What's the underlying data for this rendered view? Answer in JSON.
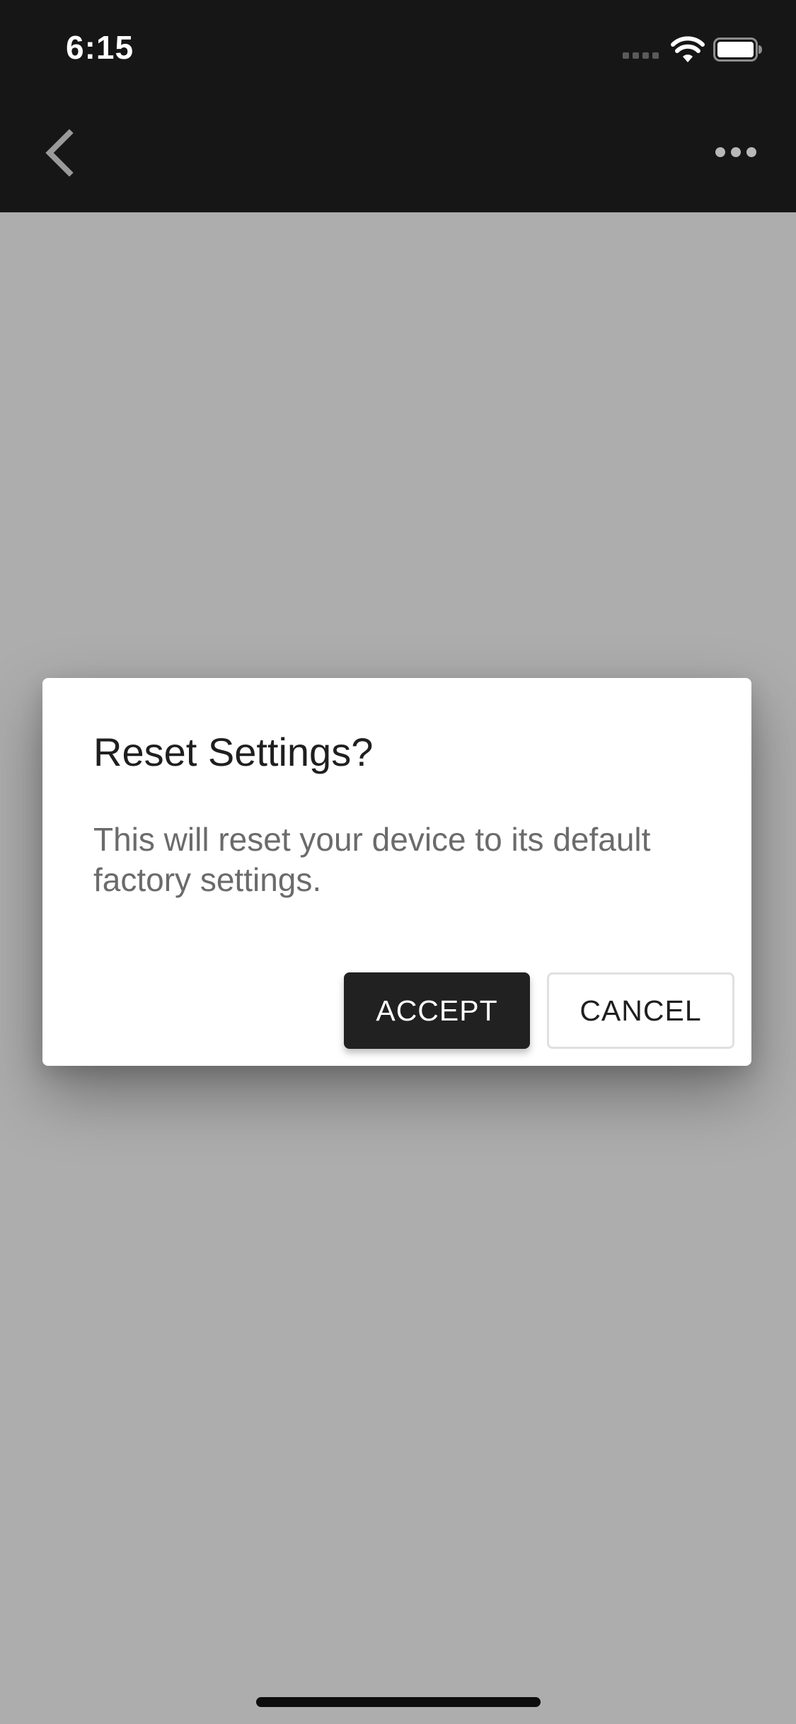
{
  "status_bar": {
    "time": "6:15",
    "icons": [
      "cellular-signal-icon",
      "wifi-icon",
      "battery-icon"
    ]
  },
  "nav_bar": {
    "back_icon": "chevron-left-icon",
    "more_icon": "more-horizontal-icon"
  },
  "dialog": {
    "title": "Reset Settings?",
    "message": "This will reset your device to its default factory settings.",
    "accept_label": "ACCEPT",
    "cancel_label": "CANCEL"
  },
  "colors": {
    "top_bar": "#161616",
    "backdrop": "#adadad",
    "dialog_bg": "#ffffff",
    "primary_button": "#212121"
  }
}
